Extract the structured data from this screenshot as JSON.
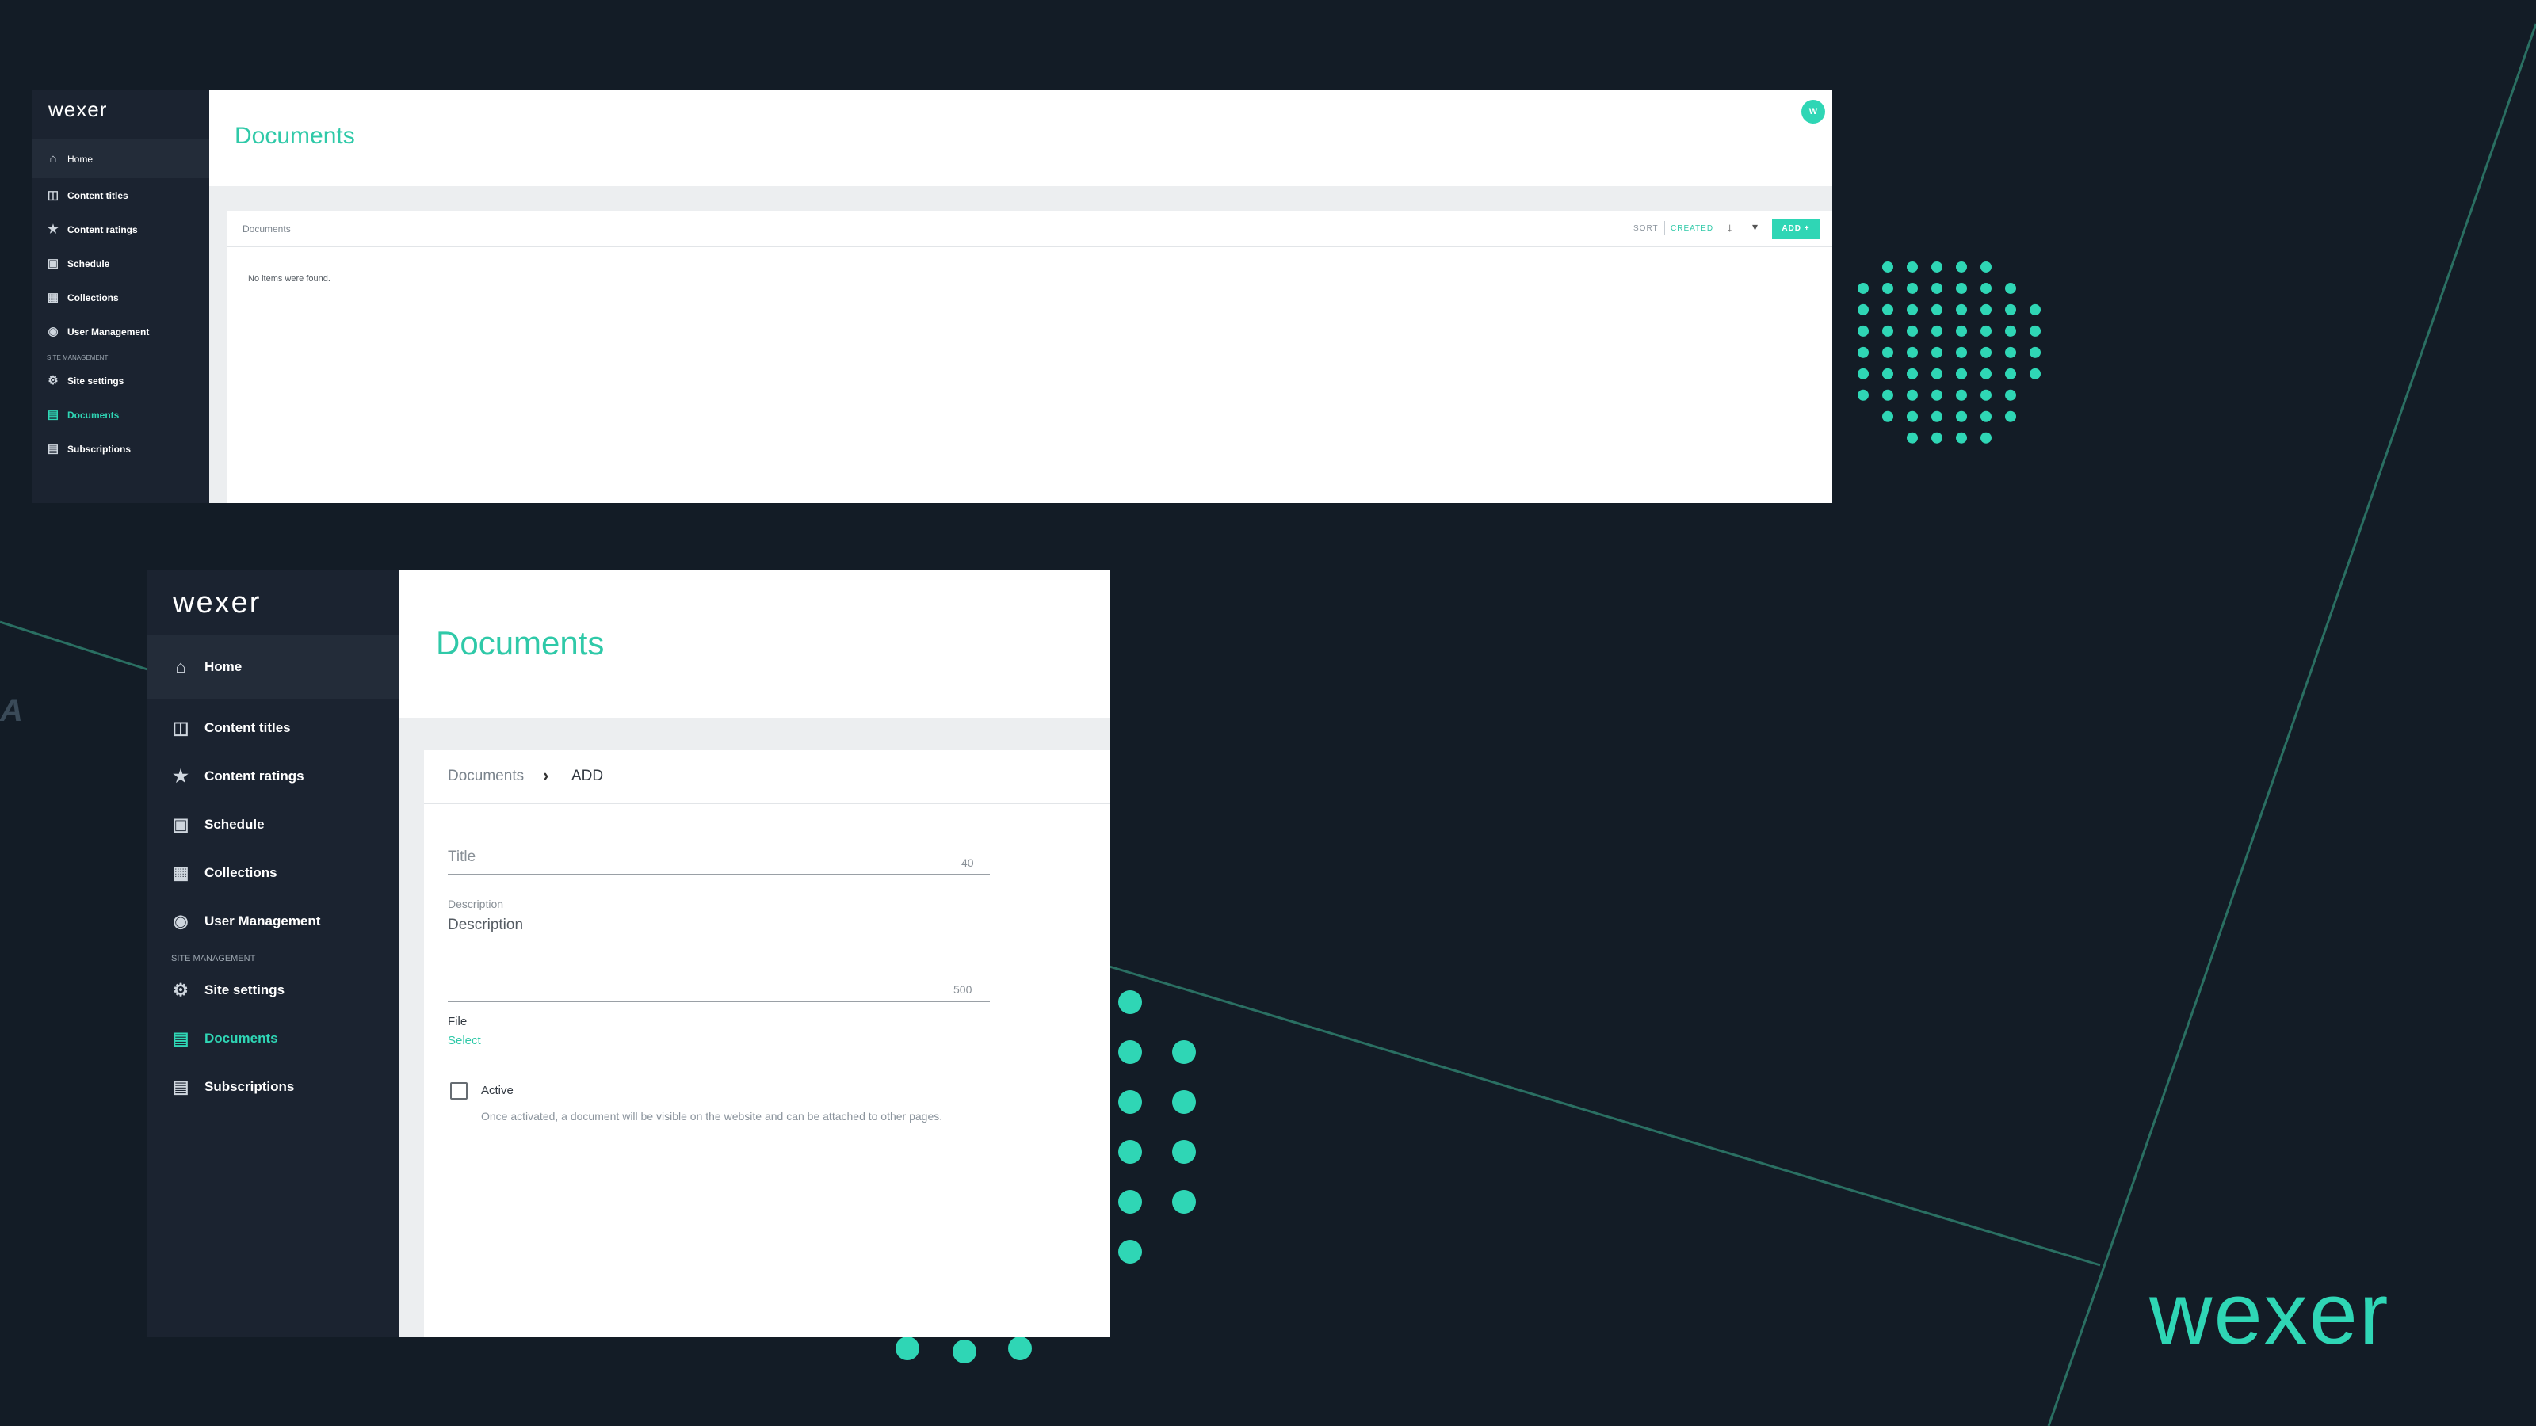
{
  "slide": {
    "brand": "wexer",
    "corner_letter": "A",
    "accent_color": "#2fd6b5",
    "background_color": "#131c26",
    "annotation_color": "#f07d28"
  },
  "screenshot_list": {
    "logo": "wexer",
    "nav": [
      {
        "label": "Home",
        "icon": "home-icon"
      },
      {
        "label": "Content titles",
        "icon": "video-library-icon"
      },
      {
        "label": "Content ratings",
        "icon": "star-icon"
      },
      {
        "label": "Schedule",
        "icon": "calendar-icon"
      },
      {
        "label": "Collections",
        "icon": "grid-icon"
      },
      {
        "label": "User Management",
        "icon": "globe-user-icon"
      },
      {
        "label": "Site settings",
        "icon": "gear-icon"
      },
      {
        "label": "Documents",
        "icon": "document-icon"
      },
      {
        "label": "Subscriptions",
        "icon": "subscriptions-icon"
      }
    ],
    "section_label": "SITE MANAGEMENT",
    "page_title": "Documents",
    "avatar": "W",
    "card_title": "Documents",
    "sort_label": "SORT",
    "sort_value": "CREATED",
    "add_label": "ADD +",
    "empty_message": "No items were found."
  },
  "screenshot_add": {
    "logo": "wexer",
    "nav": [
      {
        "label": "Home",
        "icon": "home-icon"
      },
      {
        "label": "Content titles",
        "icon": "video-library-icon"
      },
      {
        "label": "Content ratings",
        "icon": "star-icon"
      },
      {
        "label": "Schedule",
        "icon": "calendar-icon"
      },
      {
        "label": "Collections",
        "icon": "grid-icon"
      },
      {
        "label": "User Management",
        "icon": "globe-user-icon"
      },
      {
        "label": "Site settings",
        "icon": "gear-icon"
      },
      {
        "label": "Documents",
        "icon": "document-icon"
      },
      {
        "label": "Subscriptions",
        "icon": "subscriptions-icon"
      }
    ],
    "section_label": "SITE MANAGEMENT",
    "page_title": "Documents",
    "breadcrumb": [
      "Documents",
      "ADD"
    ],
    "form": {
      "title_placeholder": "Title",
      "title_max": "40",
      "description_label": "Description",
      "description_placeholder": "Description",
      "description_max": "500",
      "file_label": "File",
      "file_action": "Select",
      "active_label": "Active",
      "active_help": "Once activated, a document will be visible on the website and can be attached to other pages."
    }
  }
}
